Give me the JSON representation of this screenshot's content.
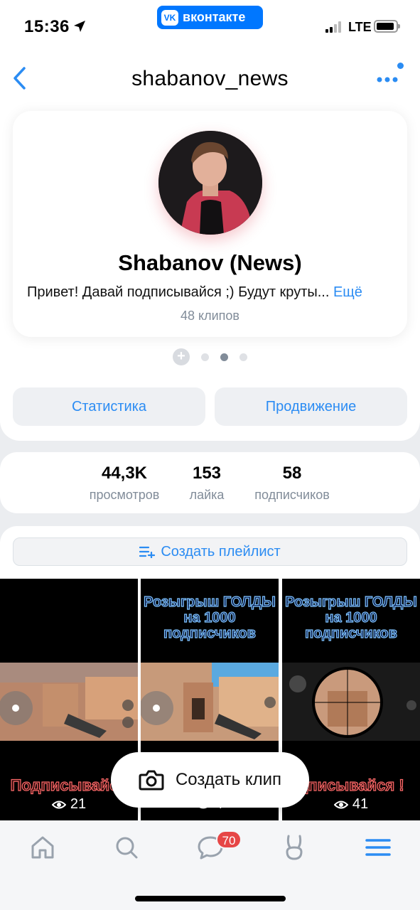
{
  "status_bar": {
    "time": "15:36",
    "network": "LTE"
  },
  "vk_banner": {
    "logo": "VK",
    "label": "вконтакте"
  },
  "header": {
    "title": "shabanov_news"
  },
  "profile": {
    "name": "Shabanov (News)",
    "description": "Привет! Давай подписывайся ;) Будут круты...",
    "more_label": "Ещё",
    "clips_count": "48 клипов"
  },
  "actions": {
    "stats_label": "Статистика",
    "promo_label": "Продвижение"
  },
  "stats": [
    {
      "value": "44,3K",
      "label": "просмотров"
    },
    {
      "value": "153",
      "label": "лайка"
    },
    {
      "value": "58",
      "label": "подписчиков"
    }
  ],
  "playlist": {
    "create_label": "Создать плейлист"
  },
  "clips": [
    {
      "promo_text": "",
      "subtitle": "Подписывайся",
      "views": "21"
    },
    {
      "promo_text": "Розыгрыш ГОЛДЫ на 1000 подписчиков",
      "subtitle": "",
      "views": "4"
    },
    {
      "promo_text": "Розыгрыш ГОЛДЫ на 1000 подписчиков",
      "subtitle": "дписывайся !",
      "views": "41"
    }
  ],
  "create_clip": {
    "label": "Создать клип"
  },
  "tabbar": {
    "messages_badge": "70"
  },
  "colors": {
    "accent": "#2b8cf3",
    "vk_blue": "#0077ff",
    "badge_red": "#e64646",
    "secondary_text": "#818c99"
  }
}
